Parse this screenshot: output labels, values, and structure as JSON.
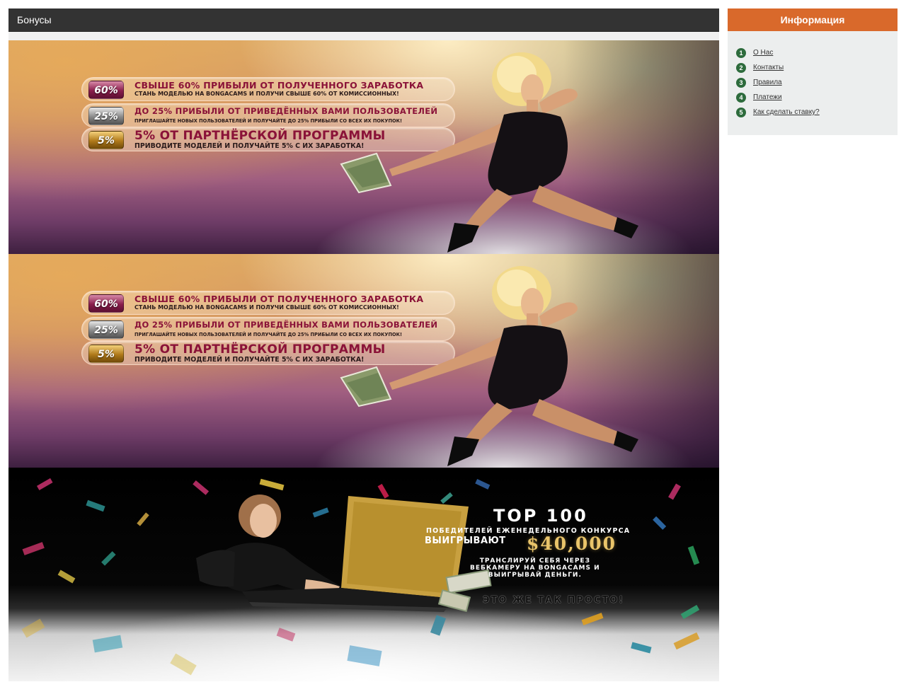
{
  "main": {
    "title": "Бонусы",
    "banners": [
      {
        "rows": [
          {
            "badge": "60%",
            "title": "СВЫШЕ 60% ПРИБЫЛИ ОТ ПОЛУЧЕННОГО ЗАРАБОТКА",
            "subtitle": "СТАНЬ МОДЕЛЬЮ НА BONGACAMS И ПОЛУЧИ СВЫШЕ 60% ОТ КОМИССИОННЫХ!"
          },
          {
            "badge": "25%",
            "title": "ДО 25% ПРИБЫЛИ ОТ ПРИВЕДЁННЫХ ВАМИ ПОЛЬЗОВАТЕЛЕЙ",
            "subtitle": "ПРИГЛАШАЙТЕ НОВЫХ ПОЛЬЗОВАТЕЛЕЙ И ПОЛУЧАЙТЕ ДО 25% ПРИБЫЛИ СО ВСЕХ ИХ ПОКУПОК!"
          },
          {
            "badge": "5%",
            "title": "5% ОТ ПАРТНЁРСКОЙ ПРОГРАММЫ",
            "subtitle": "ПРИВОДИТЕ МОДЕЛЕЙ И ПОЛУЧАЙТЕ 5% С ИХ ЗАРАБОТКА!"
          }
        ]
      },
      {
        "rows": [
          {
            "badge": "60%",
            "title": "СВЫШЕ 60% ПРИБЫЛИ ОТ ПОЛУЧЕННОГО ЗАРАБОТКА",
            "subtitle": "СТАНЬ МОДЕЛЬЮ НА BONGACAMS И ПОЛУЧИ СВЫШЕ 60% ОТ КОМИССИОННЫХ!"
          },
          {
            "badge": "25%",
            "title": "ДО 25% ПРИБЫЛИ ОТ ПРИВЕДЁННЫХ ВАМИ ПОЛЬЗОВАТЕЛЕЙ",
            "subtitle": "ПРИГЛАШАЙТЕ НОВЫХ ПОЛЬЗОВАТЕЛЕЙ И ПОЛУЧАЙТЕ ДО 25% ПРИБЫЛИ СО ВСЕХ ИХ ПОКУПОК!"
          },
          {
            "badge": "5%",
            "title": "5% ОТ ПАРТНЁРСКОЙ ПРОГРАММЫ",
            "subtitle": "ПРИВОДИТЕ МОДЕЛЕЙ И ПОЛУЧАЙТЕ 5% С ИХ ЗАРАБОТКА!"
          }
        ]
      },
      {
        "top": "TOP 100",
        "winners": "ПОБЕДИТЕЛЕЙ ЕЖЕНЕДЕЛЬНОГО КОНКУРСА",
        "win_word": "ВЫИГРЫВАЮТ",
        "amount": "$40,000",
        "stream_line1": "ТРАНСЛИРУЙ СЕБЯ ЧЕРЕЗ",
        "stream_line2": "ВЕБКАМЕРУ НА BONGACAMS И",
        "stream_line3": "ВЫИГРЫВАЙ ДЕНЬГИ.",
        "easy": "ЭТО ЖЕ ТАК ПРОСТО!"
      }
    ]
  },
  "sidebar": {
    "title": "Информация",
    "items": [
      {
        "num": "1",
        "label": "О Нас"
      },
      {
        "num": "2",
        "label": "Контакты"
      },
      {
        "num": "3",
        "label": "Правила"
      },
      {
        "num": "4",
        "label": "Платежи"
      },
      {
        "num": "5",
        "label": "Как сделать ставку?"
      }
    ]
  },
  "colors": {
    "header_bg": "#333333",
    "sidebar_header_bg": "#d9692b",
    "sidebar_bg": "#eceeee",
    "number_badge": "#2d6b3c",
    "gold_amount": "#e9c46a"
  }
}
